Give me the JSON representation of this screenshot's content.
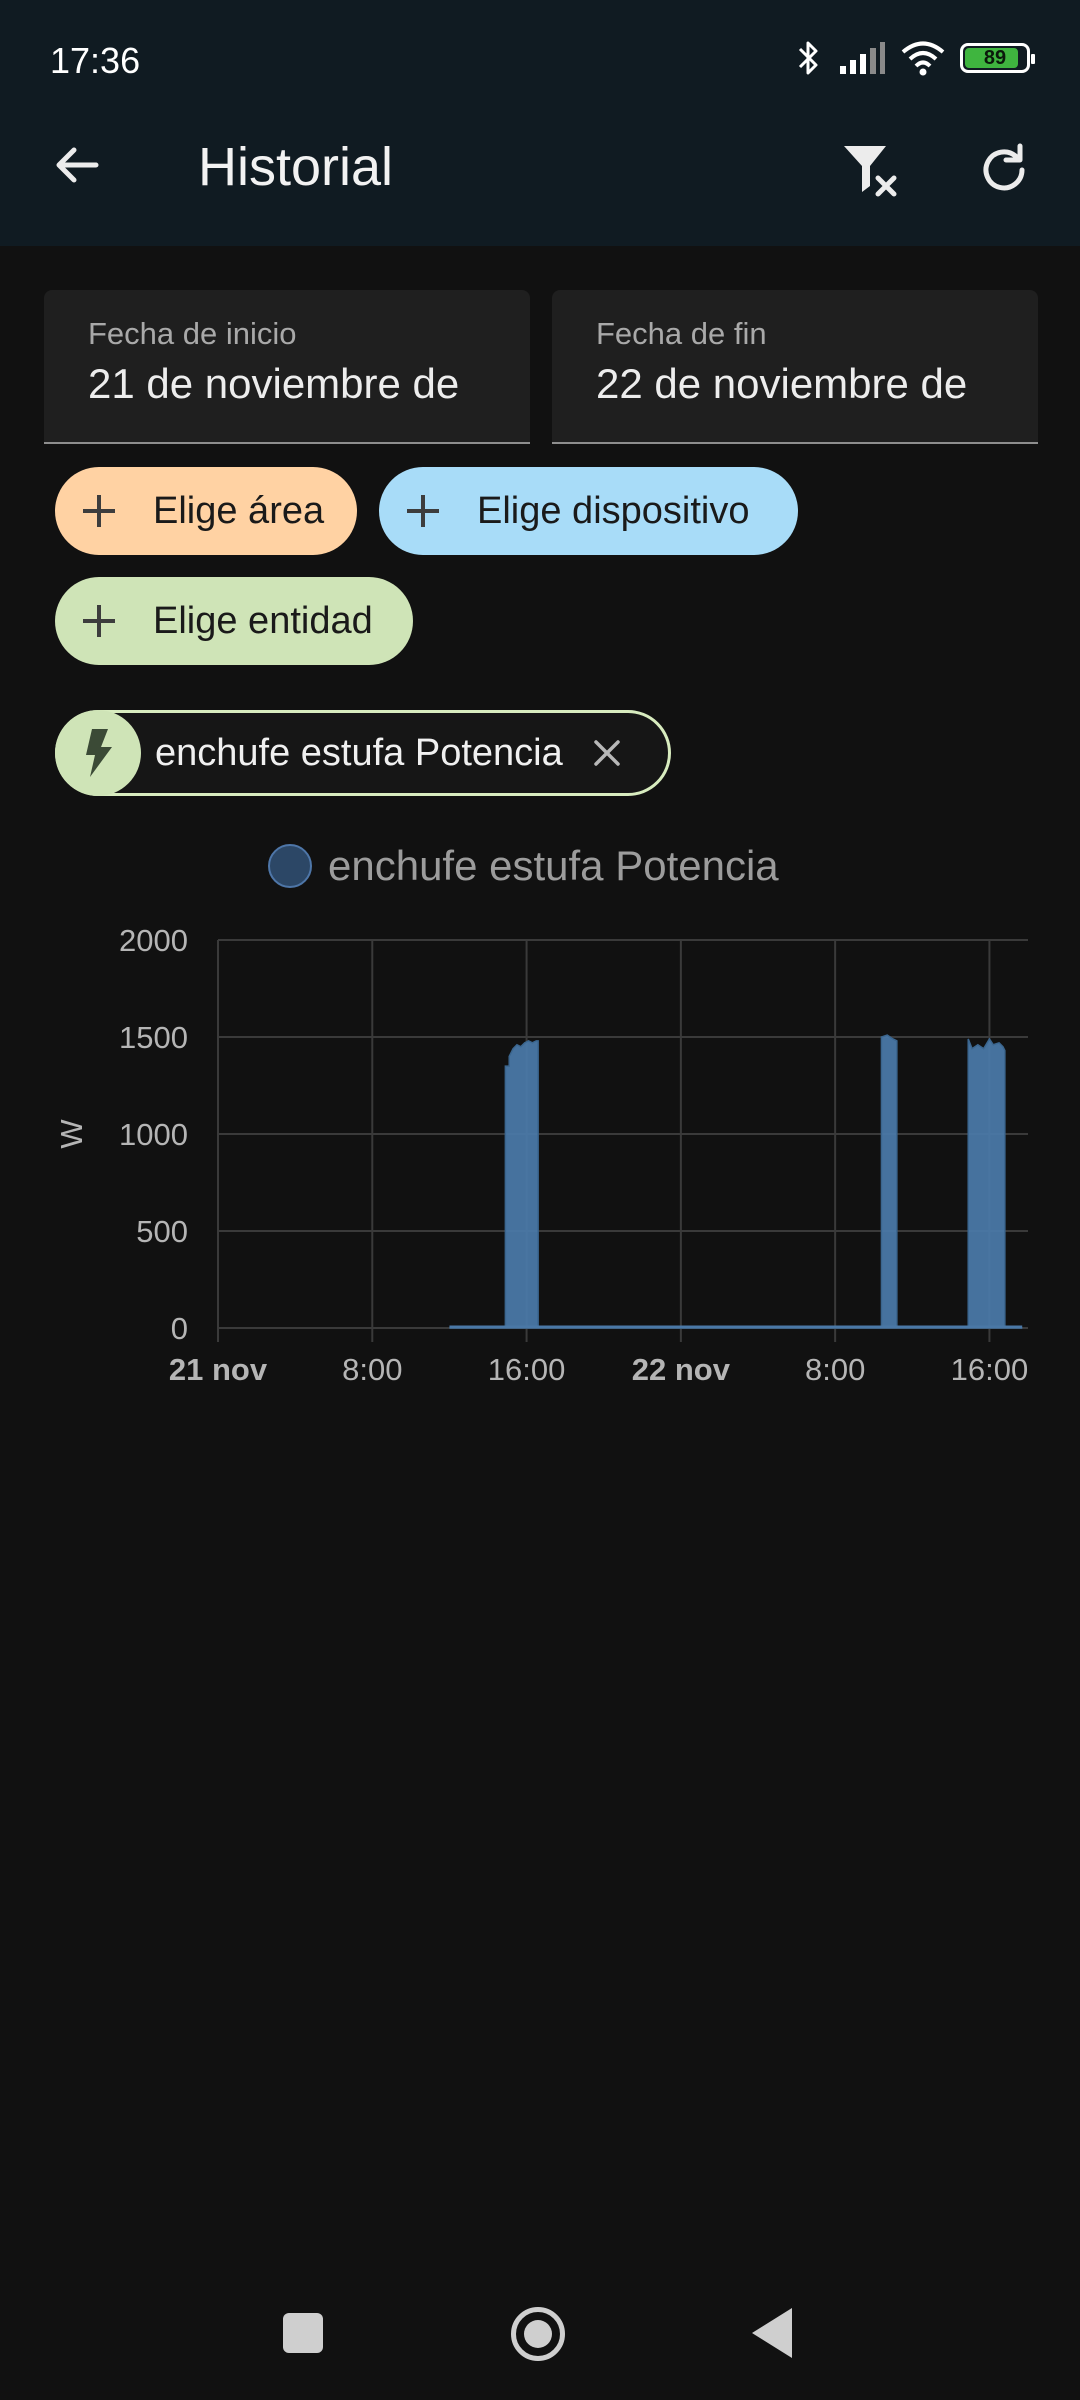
{
  "status_bar": {
    "time": "17:36",
    "battery_level": "89",
    "icons": [
      "bluetooth-icon",
      "signal-icon",
      "wifi-icon",
      "battery-icon"
    ]
  },
  "app_bar": {
    "title": "Historial",
    "icons": [
      "arrow-back-icon",
      "filter-remove-icon",
      "refresh-icon"
    ]
  },
  "dates": {
    "start_label": "Fecha de inicio",
    "start_value": "21 de noviembre de",
    "end_label": "Fecha de fin",
    "end_value": "22 de noviembre de"
  },
  "pickers": {
    "area": "Elige área",
    "device": "Elige dispositivo",
    "entity": "Elige entidad"
  },
  "selected_entity": {
    "label": "enchufe estufa Potencia",
    "icon": "flash-icon"
  },
  "colors": {
    "area_chip": "#ffd2a3",
    "device_chip": "#a8dcf8",
    "entity_chip": "#cfe4b7",
    "series": "#4a78a6",
    "background": "#111111",
    "appbar": "#101b22"
  },
  "chart_data": {
    "type": "area",
    "legend": "enchufe estufa Potencia",
    "ylabel": "W",
    "ylim": [
      0,
      2000
    ],
    "yticks": [
      "0",
      "500",
      "1000",
      "1500",
      "2000"
    ],
    "xticks": [
      {
        "label": "21 nov",
        "bold": true,
        "hour": 0
      },
      {
        "label": "8:00",
        "bold": false,
        "hour": 8
      },
      {
        "label": "16:00",
        "bold": false,
        "hour": 16
      },
      {
        "label": "22 nov",
        "bold": true,
        "hour": 24
      },
      {
        "label": "8:00",
        "bold": false,
        "hour": 32
      },
      {
        "label": "16:00",
        "bold": false,
        "hour": 40
      }
    ],
    "grid": true,
    "x_unit": "hours since 21 nov 00:00",
    "series": [
      {
        "name": "enchufe estufa Potencia",
        "points": [
          [
            12.0,
            0
          ],
          [
            14.9,
            0
          ],
          [
            14.9,
            1350
          ],
          [
            15.1,
            1350
          ],
          [
            15.1,
            1400
          ],
          [
            15.3,
            1440
          ],
          [
            15.5,
            1460
          ],
          [
            15.7,
            1450
          ],
          [
            15.9,
            1470
          ],
          [
            16.1,
            1480
          ],
          [
            16.3,
            1470
          ],
          [
            16.5,
            1480
          ],
          [
            16.6,
            1480
          ],
          [
            16.6,
            0
          ],
          [
            34.4,
            0
          ],
          [
            34.4,
            1500
          ],
          [
            34.7,
            1510
          ],
          [
            35.0,
            1490
          ],
          [
            35.2,
            1480
          ],
          [
            35.2,
            0
          ],
          [
            38.9,
            0
          ],
          [
            38.9,
            1490
          ],
          [
            39.1,
            1440
          ],
          [
            39.4,
            1460
          ],
          [
            39.7,
            1440
          ],
          [
            40.0,
            1490
          ],
          [
            40.2,
            1460
          ],
          [
            40.5,
            1470
          ],
          [
            40.7,
            1450
          ],
          [
            40.8,
            1430
          ],
          [
            40.8,
            0
          ],
          [
            41.7,
            0
          ]
        ]
      }
    ]
  },
  "nav_bar": {
    "icons": [
      "recents-icon",
      "home-icon",
      "back-icon"
    ]
  }
}
